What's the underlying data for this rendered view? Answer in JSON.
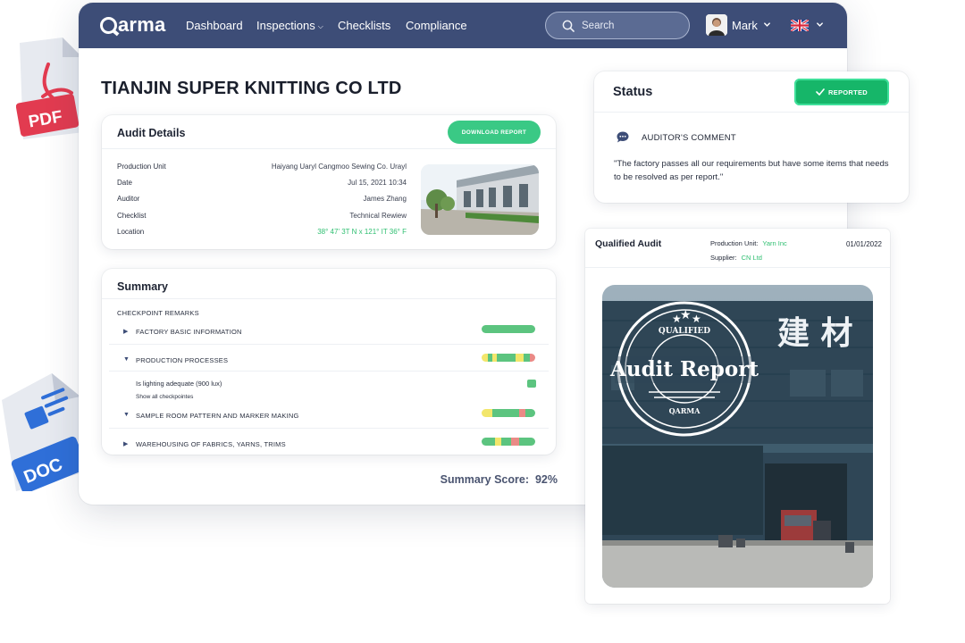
{
  "nav": {
    "logo": "qarma",
    "items": [
      {
        "label": "Dashboard"
      },
      {
        "label": "Inspections",
        "has_dropdown": true
      },
      {
        "label": "Checklists"
      },
      {
        "label": "Compliance"
      }
    ],
    "search_placeholder": "Search",
    "user_name": "Mark",
    "language_flag": "uk-flag-icon"
  },
  "page": {
    "company_name": "TIANJIN SUPER KNITTING CO LTD"
  },
  "audit_details": {
    "title": "Audit Details",
    "download_label": "DOWNLOAD REPORT",
    "rows": [
      {
        "key": "Production Unit",
        "value": "Haiyang Uaryl Cangmoo Sewing Co. Urayl"
      },
      {
        "key": "Date",
        "value": "Jul 15, 2021 10:34"
      },
      {
        "key": "Auditor",
        "value": "James Zhang"
      },
      {
        "key": "Checklist",
        "value": "Technical Rewiew"
      },
      {
        "key": "Location",
        "value": "38° 47' 3T N x 121° IT 36° F"
      }
    ]
  },
  "summary": {
    "title": "Summary",
    "section_label": "CHECKPOINT REMARKS",
    "rows": [
      {
        "label": "FACTORY BASIC INFORMATION",
        "expanded": false
      },
      {
        "label": "PRODUCTION PROCESSES",
        "expanded": true
      },
      {
        "label": "SAMPLE ROOM PATTERN AND MARKER MAKING",
        "expanded": true
      },
      {
        "label": "WAREHOUSING OF FABRICS, YARNS, TRIMS",
        "expanded": false
      }
    ],
    "sub_item": "Is lighting adequate (900 lux)",
    "show_all_link": "Show all checkpointes",
    "score_label": "Summary Score:",
    "score_value": "92%"
  },
  "status": {
    "title": "Status",
    "badge": "REPORTED",
    "comment_label": "AUDITOR'S COMMENT",
    "comment_text": "\"The factory passes all our requirements but have some items that needs to be resolved as per report.\""
  },
  "qualified_audit": {
    "title": "Qualified Audit",
    "production_unit_label": "Production Unit:",
    "production_unit_value": "Yarn Inc",
    "supplier_label": "Supplier:",
    "supplier_value": "CN Ltd",
    "date": "01/01/2022",
    "stamp": {
      "top_text": "QUALIFIED",
      "main_text": "Audit Report",
      "bottom_text": "QARMA"
    }
  },
  "file_icons": {
    "pdf_label": "PDF",
    "doc_label": "DOC"
  },
  "colors": {
    "nav_bg": "#3d4d77",
    "accent_green": "#3ac985",
    "status_green": "#16b669",
    "bar_green": "#5cc47f",
    "bar_yellow": "#f2e66b",
    "bar_red": "#ea8a86"
  }
}
